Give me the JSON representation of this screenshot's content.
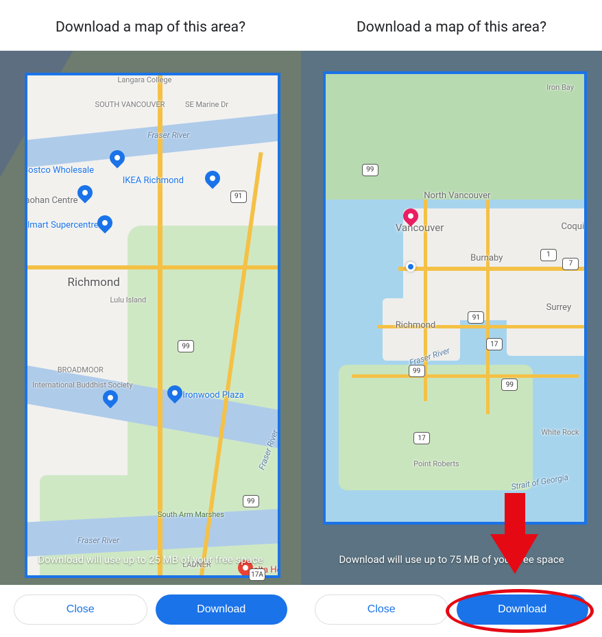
{
  "left": {
    "title": "Download a map of this area?",
    "storage": "Download will use up to 25 MB of your free space",
    "close": "Close",
    "download": "Download",
    "labels": {
      "langara": "Langara College",
      "south_vancouver": "SOUTH VANCOUVER",
      "se_marine": "SE Marine Dr",
      "fraser_river": "Fraser River",
      "costco": "Costco Wholesale",
      "ikea": "IKEA Richmond",
      "yaohan": "Yaohan Centre",
      "walmart": "Walmart Supercentre",
      "richmond": "Richmond",
      "lulu": "Lulu Island",
      "broadmoor": "BROADMOOR",
      "buddhist": "International Buddhist Society",
      "ironwood": "Ironwood Plaza",
      "south_arm": "South Arm Marshes",
      "ladner": "LADNER",
      "delta": "Delta Hos",
      "hwy91": "91",
      "hwy99": "99",
      "hwy99b": "99",
      "hwy17a": "17A"
    }
  },
  "right": {
    "title": "Download a map of this area?",
    "storage": "Download will use up to 75 MB of your free space",
    "close": "Close",
    "download": "Download",
    "labels": {
      "iron_bay": "Iron Bay",
      "north_vancouver": "North Vancouver",
      "vancouver": "Vancouver",
      "burnaby": "Burnaby",
      "coquitlam": "Coquitl",
      "richmond": "Richmond",
      "surrey": "Surrey",
      "fraser_river": "Fraser River",
      "white_rock": "White Rock",
      "point_roberts": "Point Roberts",
      "strait": "Strait of Georgia",
      "hwy99a": "99",
      "hwy1": "1",
      "hwy7": "7",
      "hwy91": "91",
      "hwy17a": "17",
      "hwy99b": "99",
      "hwy99c": "99",
      "hwy17b": "17"
    }
  }
}
